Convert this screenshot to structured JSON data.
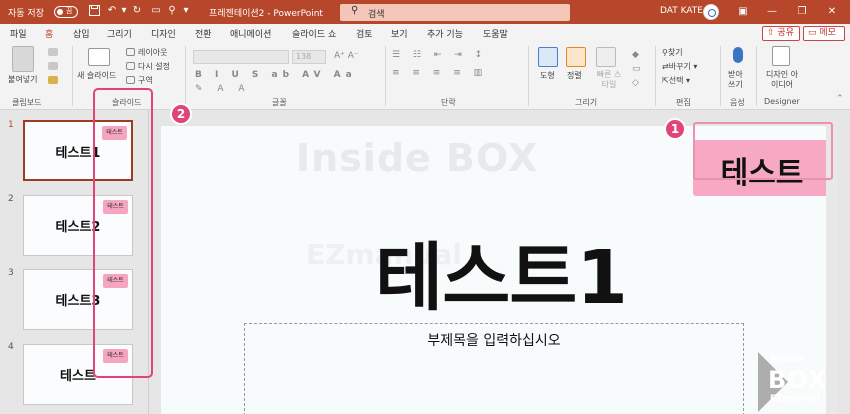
{
  "titlebar": {
    "autosave_label": "자동 저장",
    "autosave_state": "끔",
    "doc_title": "프레젠테이션2 - PowerPoint",
    "search_placeholder": "검색",
    "user_name": "DAT KATE"
  },
  "menu": {
    "tabs": [
      "파일",
      "홈",
      "삽입",
      "그리기",
      "디자인",
      "전환",
      "애니메이션",
      "슬라이드 쇼",
      "검토",
      "보기",
      "추가 기능",
      "도움말"
    ],
    "active": "홈",
    "share": "공유",
    "memo": "메모"
  },
  "ribbon": {
    "paste": "붙여넣기",
    "clipboard": "클립보드",
    "new_slide": "새 슬라이드",
    "layout": "레이아웃",
    "reset": "다시 설정",
    "section": "구역",
    "slides_group": "슬라이드",
    "font_size": "138",
    "font_group": "글꼴",
    "paragraph_group": "단락",
    "shape": "도형",
    "arrange": "정렬",
    "quick_style": "빠른 스타일",
    "drawing_group": "그리기",
    "find": "찾기",
    "replace": "바꾸기",
    "select": "선택",
    "editing_group": "편집",
    "dictate": "받아쓰기",
    "voice_group": "음성",
    "designer_ideas": "디자인 아이디어",
    "designer_group": "Designer"
  },
  "slides": [
    {
      "num": "1",
      "title": "테스트1",
      "badge": "테스트",
      "selected": true
    },
    {
      "num": "2",
      "title": "테스트2",
      "badge": "테스트",
      "selected": false
    },
    {
      "num": "3",
      "title": "테스트3",
      "badge": "테스트",
      "selected": false
    },
    {
      "num": "4",
      "title": "테스트",
      "badge": "테스트",
      "selected": false
    }
  ],
  "slide": {
    "badge_text": "테스트",
    "title": "테스트1",
    "subtitle_placeholder": "부제목을 입력하십시오",
    "watermark1": "Inside BOX",
    "watermark2": "EZmanual"
  },
  "annotations": {
    "callout1": "1",
    "callout2": "2"
  },
  "logo": {
    "line1": "Inside",
    "line2": "BOX",
    "line3": "EZmanual"
  },
  "colors": {
    "accent": "#b7472a",
    "badge_pink": "#f7a9c4",
    "annotation_pink": "#e0457a"
  }
}
